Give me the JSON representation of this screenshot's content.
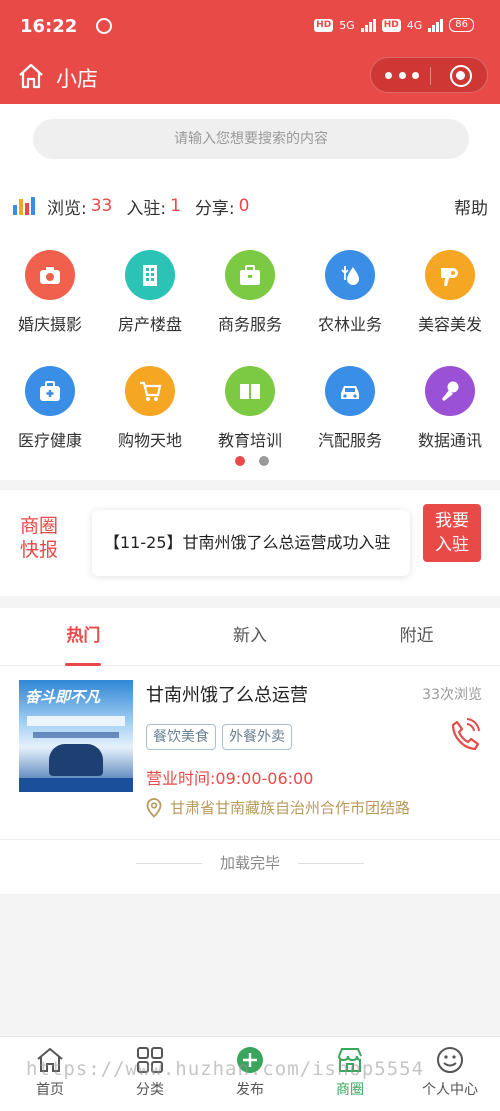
{
  "status_bar": {
    "time": "16:22",
    "hd1": "HD",
    "net1": "5G",
    "hd2": "HD",
    "net2": "4G",
    "battery": "86"
  },
  "header": {
    "title": "小店"
  },
  "search": {
    "placeholder": "请输入您想要搜索的内容"
  },
  "stats": {
    "views_label": "浏览:",
    "views": "33",
    "join_label": "入驻:",
    "join": "1",
    "share_label": "分享:",
    "share": "0",
    "help": "帮助"
  },
  "categories": [
    {
      "label": "婚庆摄影",
      "icon": "camera-icon",
      "color": "#f1604c"
    },
    {
      "label": "房产楼盘",
      "icon": "building-icon",
      "color": "#2bc3b5"
    },
    {
      "label": "商务服务",
      "icon": "briefcase-icon",
      "color": "#7cc943"
    },
    {
      "label": "农林业务",
      "icon": "droplet-icon",
      "color": "#3a8ee6"
    },
    {
      "label": "美容美发",
      "icon": "hairdryer-icon",
      "color": "#f5a623"
    },
    {
      "label": "医疗健康",
      "icon": "medkit-icon",
      "color": "#3a8ee6"
    },
    {
      "label": "购物天地",
      "icon": "cart-icon",
      "color": "#f5a623"
    },
    {
      "label": "教育培训",
      "icon": "book-icon",
      "color": "#7cc943"
    },
    {
      "label": "汽配服务",
      "icon": "car-icon",
      "color": "#3a8ee6"
    },
    {
      "label": "数据通讯",
      "icon": "microphone-icon",
      "color": "#9b51d6"
    }
  ],
  "news": {
    "tag_line1": "商圈",
    "tag_line2": "快报",
    "headline": "【11-25】甘南州饿了么总运营成功入驻",
    "join_line1": "我要",
    "join_line2": "入驻"
  },
  "tabs": [
    {
      "label": "热门",
      "active": true
    },
    {
      "label": "新入",
      "active": false
    },
    {
      "label": "附近",
      "active": false
    }
  ],
  "listing": {
    "name": "甘南州饿了么总运营",
    "views": "33次浏览",
    "tags": [
      "餐饮美食",
      "外餐外卖"
    ],
    "hours": "营业时间:09:00-06:00",
    "address": "甘肃省甘南藏族自治州合作市团结路",
    "thumb_title": "奋斗即不凡"
  },
  "load_done": "加载完毕",
  "bottom_nav": [
    {
      "label": "首页",
      "active": false
    },
    {
      "label": "分类",
      "active": false
    },
    {
      "label": "发布",
      "active": false
    },
    {
      "label": "商圈",
      "active": true
    },
    {
      "label": "个人中心",
      "active": false
    }
  ],
  "watermark": "https://www.huzhan.com/ishop5554",
  "colors": {
    "brand": "#e84a48",
    "nav_active": "#3aa55c",
    "address": "#b79a5c"
  }
}
